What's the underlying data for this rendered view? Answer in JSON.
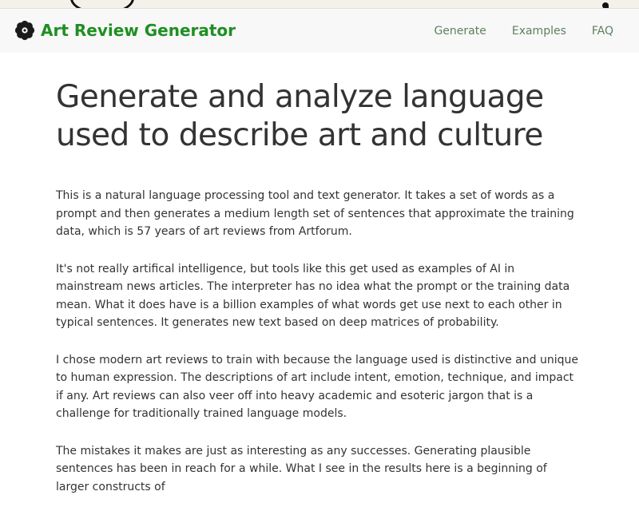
{
  "navbar": {
    "brand": "Art Review Generator",
    "brand_icon": "flower-icon",
    "links": [
      "Generate",
      "Examples",
      "FAQ"
    ]
  },
  "main": {
    "title": "Generate and analyze language used to describe art and culture",
    "paragraphs": [
      "This is a natural language processing tool and text generator. It takes a set of words as a prompt and then generates a medium length set of sentences that approximate the training data, which is 57 years of art reviews from Artforum.",
      "It's not really artifical intelligence, but tools like this get used as examples of AI in mainstream news articles. The interpreter has no idea what the prompt or the training data mean. What it does have is a billion examples of what words get use next to each other in typical sentences. It generates new text based on deep matrices of probability.",
      "I chose modern art reviews to train with because the language used is distinctive and unique to human expression. The descriptions of art include intent, emotion, technique, and impact if any. Art reviews can also veer off into heavy academic and esoteric jargon that is a challenge for traditionally trained language models.",
      "The mistakes it makes are just as interesting as any successes. Generating plausible sentences has been in reach for a while. What I see in the results here is a beginning of larger constructs of"
    ]
  },
  "colors": {
    "brand": "#1e8f22",
    "nav_link": "#5f7f5f",
    "navbar_bg": "#f8f8f8",
    "text": "#333333"
  }
}
